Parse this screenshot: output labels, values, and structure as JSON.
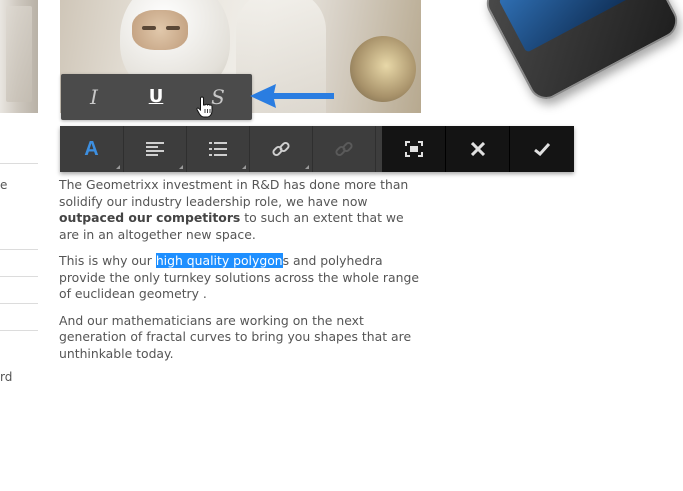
{
  "left_column": {
    "fragments": [
      "e",
      "rd"
    ]
  },
  "inline_toolbar": {
    "italic_label": "I",
    "underline_label": "U",
    "strikethrough_label": "S"
  },
  "main_toolbar": {
    "format_label": "A",
    "accent_color": "#3d8fe0",
    "icons": [
      "paragraph-align-icon",
      "list-icon",
      "link-icon",
      "unlink-icon",
      "fullscreen-icon",
      "close-icon",
      "check-icon"
    ]
  },
  "article": {
    "p1_before": "The Geometrixx investment in R&D has done more than solidify our industry leadership role, we have now ",
    "p1_bold": "outpaced our competitors",
    "p1_after": " to such an extent that we are in an altogether new space.",
    "p2_before": "This is why our ",
    "p2_selected": "high quality polygon",
    "p2_after": "s and polyhedra provide the only turnkey solutions across the whole range of euclidean geometry .",
    "p3": "And our mathematicians are working on the next generation of fractal curves to bring you shapes that are unthinkable today."
  },
  "colors": {
    "selection": "#1e8fff",
    "arrow": "#2a7de1",
    "toolbar_bg": "#3d3d3d"
  }
}
